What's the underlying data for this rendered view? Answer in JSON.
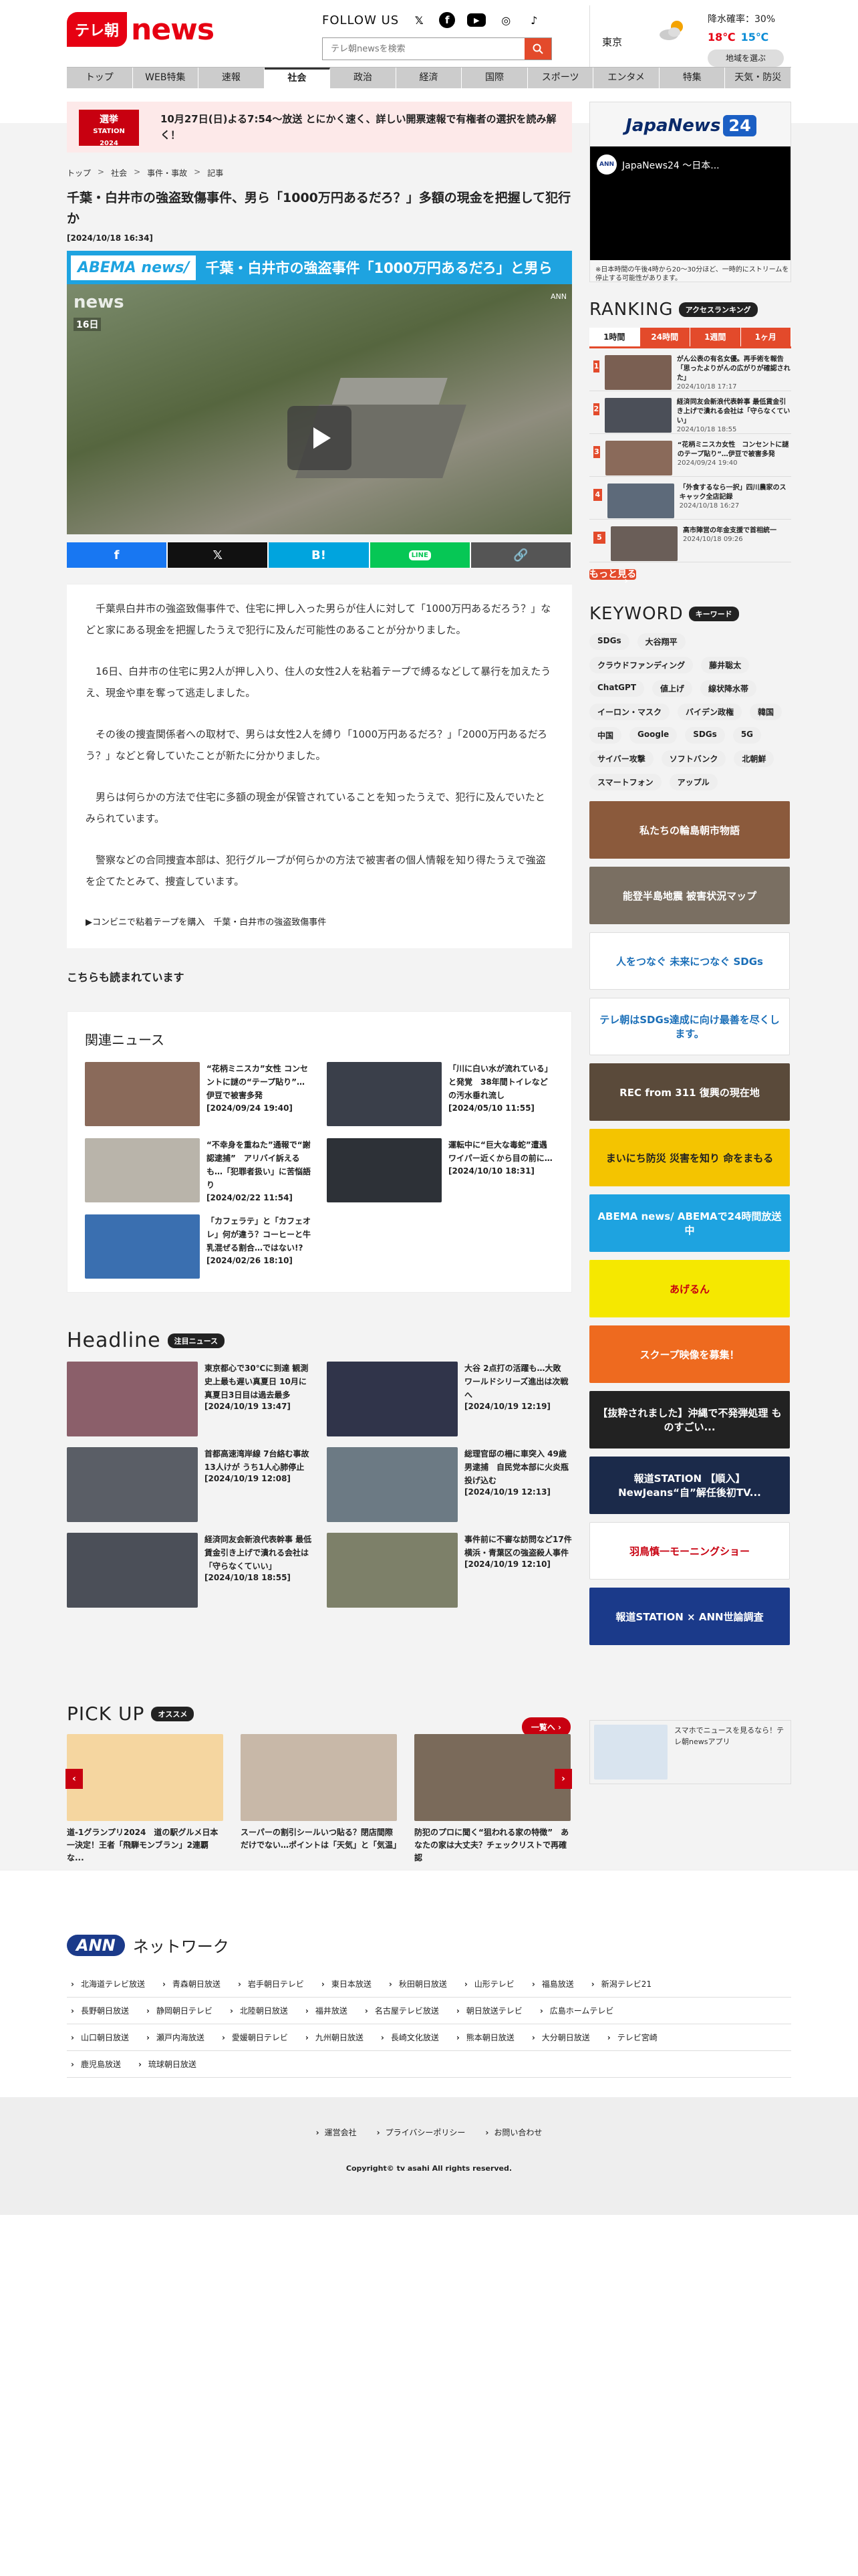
{
  "header": {
    "logo_mark": "テレ朝",
    "logo_text": "news",
    "follow_label": "FOLLOW US",
    "sns": [
      {
        "icon": "x-icon",
        "glyph": "𝕏"
      },
      {
        "icon": "facebook-icon",
        "glyph": "f"
      },
      {
        "icon": "youtube-icon",
        "glyph": "▶"
      },
      {
        "icon": "instagram-icon",
        "glyph": "◎"
      },
      {
        "icon": "tiktok-icon",
        "glyph": "♪"
      }
    ],
    "search_placeholder": "テレ朝newsを検索"
  },
  "weather": {
    "city": "東京",
    "rain": "降水確率：30%",
    "high": "18℃",
    "low": "15℃",
    "area_button": "地域を選ぶ"
  },
  "gnav": [
    "トップ",
    "WEB特集",
    "速報",
    "社会",
    "政治",
    "経済",
    "国際",
    "スポーツ",
    "エンタメ",
    "特集",
    "天気・防災"
  ],
  "gnav_active": 3,
  "election": {
    "badge_line1": "選挙",
    "badge_line2": "STATION",
    "badge_line3": "2024",
    "text": "10月27日(日)よる7:54～放送 とにかく速く、詳しい開票速報で有権者の選択を読み解く！"
  },
  "breadcrumb": [
    "トップ",
    "社会",
    "事件・事故",
    "記事"
  ],
  "article": {
    "title": "千葉・白井市の強盗致傷事件、男ら「1000万円あるだろ？」多額の現金を把握して犯行か",
    "date": "[2024/10/18 16:34]",
    "video_brand": "ABEMA news/",
    "video_title": "千葉・白井市の強盗事件「1000万円あるだろ」と男ら",
    "video_watermark": "news",
    "video_day": "16日",
    "video_ann": "ANN",
    "paragraphs": [
      "千葉県白井市の強盗致傷事件で、住宅に押し入った男らが住人に対して「1000万円あるだろう？」などと家にある現金を把握したうえで犯行に及んだ可能性のあることが分かりました。",
      "16日、白井市の住宅に男2人が押し入り、住人の女性2人を粘着テープで縛るなどして暴行を加えたうえ、現金や車を奪って逃走しました。",
      "その後の捜査関係者への取材で、男らは女性2人を縛り「1000万円あるだろ？」「2000万円あるだろう？」などと脅していたことが新たに分かりました。",
      "男らは何らかの方法で住宅に多額の現金が保管されていることを知ったうえで、犯行に及んでいたとみられています。",
      "警察などの合同捜査本部は、犯行グループが何らかの方法で被害者の個人情報を知り得たうえで強盗を企てたとみて、捜査しています。"
    ],
    "related_link": "▶コンビニで粘着テープを購入　千葉・白井市の強盗致傷事件"
  },
  "share": {
    "facebook": "f",
    "x": "𝕏",
    "hatena": "B!",
    "line": "LINE",
    "link": "🔗"
  },
  "also_read": "こちらも読まれています",
  "related_news": {
    "title": "関連ニュース",
    "items": [
      {
        "title": "“花柄ミニスカ”女性 コンセントに謎の“テープ貼り”…伊豆で被害多発",
        "date": "[2024/09/24 19:40]",
        "color": "#8a6a5a"
      },
      {
        "title": "「川に白い水が流れている」と発覚　38年間トイレなどの汚水垂れ流し",
        "date": "[2024/05/10 11:55]",
        "color": "#3a3f4a"
      },
      {
        "title": "“不幸身を重ねた”通報で“謝認逮捕”　アリバイ訴えるも…「犯罪者扱い」に苦悩語り",
        "date": "[2024/02/22 11:54]",
        "color": "#b9b4aa"
      },
      {
        "title": "運転中に“巨大な毒蛇”遭遇　ワイパー近くから目の前に…",
        "date": "[2024/10/10 18:31]",
        "color": "#2d3137"
      },
      {
        "title": "「カフェラテ」と「カフェオレ」何が違う？コーヒーと牛乳混ぜる割合…ではない!?",
        "date": "[2024/02/26 18:10]",
        "color": "#3a6fb0"
      }
    ]
  },
  "headline": {
    "title": "Headline",
    "tag": "注目ニュース",
    "items": [
      {
        "title": "東京都心で30℃に到達 観測史上最も遅い真夏日 10月に真夏日3日目は過去最多",
        "date": "[2024/10/19 13:47]",
        "color": "#8b5f6a"
      },
      {
        "title": "大谷 2点打の活躍も…大敗　ワールドシリーズ進出は次戦へ",
        "date": "[2024/10/19 12:19]",
        "color": "#30344a"
      },
      {
        "title": "首都高速湾岸線 7台絡む事故　13人けが うち1人心肺停止",
        "date": "[2024/10/19 12:08]",
        "color": "#5a5e66"
      },
      {
        "title": "総理官邸の柵に車突入 49歳男逮捕　自民党本部に火炎瓶投げ込む",
        "date": "[2024/10/19 12:13]",
        "color": "#6c7a84"
      },
      {
        "title": "経済同友会新浪代表幹事 最低賃金引き上げで潰れる会社は「守らなくていい」",
        "date": "[2024/10/18 18:55]",
        "color": "#4b4f58"
      },
      {
        "title": "事件前に不審な訪問など17件　横浜・青葉区の強盗殺人事件",
        "date": "[2024/10/19 12:10]",
        "color": "#7d8069"
      }
    ]
  },
  "sidebar": {
    "jn24_left": "JapaNews",
    "jn24_right": "24",
    "player_icon": "ANN",
    "player_title": "JapaNews24 ～日本...",
    "note": "※日本時間の午後4時から20～30分ほど、一時的にストリームを停止する可能性があります。",
    "ranking_title": "RANKING",
    "ranking_tag": "アクセスランキング",
    "rank_tabs": [
      "1時間",
      "24時間",
      "1週間",
      "1ヶ月"
    ],
    "rank_active": 0,
    "ranks": [
      {
        "no": "1",
        "title": "がん公表の有名女優。再手術を報告「思ったよりがんの広がりが確認された」",
        "date": "2024/10/18 17:17",
        "color": "#7a5f52"
      },
      {
        "title": "経済同友会新浪代表幹事 最低賃金引き上げで潰れる会社は「守らなくていい」",
        "no": "2",
        "date": "2024/10/18 18:55",
        "color": "#4b4f58"
      },
      {
        "no": "3",
        "title": "“花柄ミニスカ女性　コンセントに謎のテープ貼り”…伊豆で被害多発",
        "date": "2024/09/24 19:40",
        "color": "#8a6a5a"
      },
      {
        "no": "4",
        "title": "「外食するなら一択」四川農家のスキャック全店記録",
        "date": "2024/10/18 16:27",
        "color": "#5d6a7a"
      },
      {
        "no": "5",
        "title": "高市陣営の年金支援で首相統一",
        "date": "2024/10/18 09:26",
        "color": "#6a5e58"
      }
    ],
    "more": "もっと見る",
    "keyword_title": "KEYWORD",
    "keyword_tag": "キーワード",
    "keywords": [
      "SDGs",
      "大谷翔平",
      "クラウドファンディング",
      "藤井聡太",
      "ChatGPT",
      "値上げ",
      "線状降水帯",
      "イーロン・マスク",
      "バイデン政権",
      "韓国",
      "中国",
      "Google",
      "SDGs",
      "5G",
      "サイバー攻撃",
      "ソフトバンク",
      "北朝鮮",
      "スマートフォン",
      "アップル"
    ],
    "banners": [
      {
        "label": "私たちの輪島朝市物語",
        "bg": "#8b5a3c",
        "fg": "#fff"
      },
      {
        "label": "能登半島地震 被害状況マップ",
        "bg": "#7a6f62",
        "fg": "#fff"
      },
      {
        "label": "人をつなぐ 未来につなぐ SDGs",
        "bg": "#ffffff",
        "fg": "#1b6fb8"
      },
      {
        "label": "テレ朝はSDGs達成に向け最善を尽くします。",
        "bg": "#ffffff",
        "fg": "#1b6fb8"
      },
      {
        "label": "REC from 311 復興の現在地",
        "bg": "#5a4a3a",
        "fg": "#fff"
      },
      {
        "label": "まいにち防災 災害を知り 命をまもる",
        "bg": "#f4c400",
        "fg": "#222"
      },
      {
        "label": "ABEMA news/ ABEMAで24時間放送中",
        "bg": "#1ea3e0",
        "fg": "#fff"
      },
      {
        "label": "あげるん",
        "bg": "#f5e800",
        "fg": "#c80010"
      },
      {
        "label": "スクープ映像を募集！",
        "bg": "#ee6a1f",
        "fg": "#fff"
      },
      {
        "label": "【抜粋されました】沖縄で不発弾処理 ものすごい...",
        "bg": "#222222",
        "fg": "#fff"
      },
      {
        "label": "報道STATION 【順入】NewJeans“自”解任後初TV...",
        "bg": "#1b2a4a",
        "fg": "#fff"
      },
      {
        "label": "羽鳥慎一モーニングショー",
        "bg": "#ffffff",
        "fg": "#c80010"
      },
      {
        "label": "報道STATION × ANN世論調査",
        "bg": "#1b3a8a",
        "fg": "#fff"
      }
    ]
  },
  "pickup": {
    "title": "PICK UP",
    "tag": "オススメ",
    "all": "一覧へ",
    "items": [
      {
        "title": "道-1グランプリ2024　道の駅グルメ日本一決定！王者「飛騨モンブラン」2連覇な...",
        "color": "#f5d6a0"
      },
      {
        "title": "スーパーの割引シールいつ貼る？閉店間際だけでない…ポイントは「天気」と「気温」",
        "color": "#c8b8a8"
      },
      {
        "title": "防犯のプロに聞く“狙われる家の特徴”　あなたの家は大丈夫？チェックリストで再確認",
        "color": "#7a6a5a"
      }
    ],
    "side_text": "スマホでニュースを見るなら！テレ朝newsアプリ"
  },
  "network": {
    "logo": "ANN",
    "label": "ネットワーク",
    "rows": [
      [
        "北海道テレビ放送",
        "青森朝日放送",
        "岩手朝日テレビ",
        "東日本放送",
        "秋田朝日放送",
        "山形テレビ",
        "福島放送",
        "新潟テレビ21"
      ],
      [
        "長野朝日放送",
        "静岡朝日テレビ",
        "北陸朝日放送",
        "福井放送",
        "名古屋テレビ放送",
        "朝日放送テレビ",
        "広島ホームテレビ"
      ],
      [
        "山口朝日放送",
        "瀬戸内海放送",
        "愛媛朝日テレビ",
        "九州朝日放送",
        "長崎文化放送",
        "熊本朝日放送",
        "大分朝日放送",
        "テレビ宮崎"
      ],
      [
        "鹿児島放送",
        "琉球朝日放送"
      ]
    ]
  },
  "footer": {
    "links": [
      "運営会社",
      "プライバシーポリシー",
      "お問い合わせ"
    ],
    "copyright": "Copyright© tv asahi All rights reserved."
  }
}
